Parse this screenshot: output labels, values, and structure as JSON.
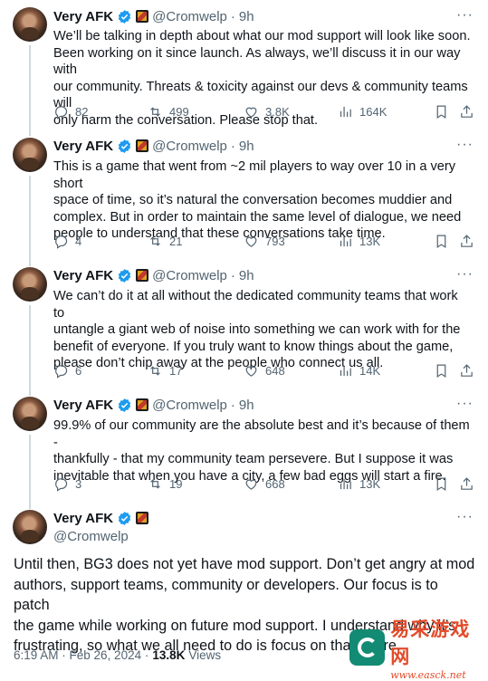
{
  "author": {
    "name": "Very AFK",
    "handle": "@Cromwelp"
  },
  "more_label": "···",
  "tweets": [
    {
      "time": "9h",
      "text": "We’ll be talking in depth about what our mod support will look like soon.\nBeen working on it since launch. As always, we’ll discuss it in our way with\nour community. Threats & toxicity against our devs & community teams will\nonly harm the conversation. Please stop that.",
      "replies": "82",
      "retweets": "499",
      "likes": "3.8K",
      "views": "164K"
    },
    {
      "time": "9h",
      "text": "This is a game that went from ~2 mil players to way over 10 in a very short\nspace of time, so it’s natural the conversation becomes muddier and\ncomplex. But in order to maintain the same level of dialogue, we need\npeople to understand that these conversations take time.",
      "replies": "4",
      "retweets": "21",
      "likes": "793",
      "views": "13K"
    },
    {
      "time": "9h",
      "text": "We can’t do it at all without the dedicated community teams that work to\nuntangle a giant web of noise into something we can work with for the\nbenefit of everyone. If you truly want to know things about the game,\nplease don’t chip away at the people who connect us all.",
      "replies": "6",
      "retweets": "17",
      "likes": "648",
      "views": "14K"
    },
    {
      "time": "9h",
      "text": "99.9% of our community are the absolute best and it’s because of them -\nthankfully - that my community team persevere. But I suppose it was\ninevitable that when you have a city, a few bad eggs will start a fire.",
      "replies": "3",
      "retweets": "19",
      "likes": "668",
      "views": "13K"
    }
  ],
  "main_tweet": {
    "text": "Until then, BG3 does not yet have mod support. Don’t get angry at mod\nauthors, support teams, community or developers. Our focus is to patch\nthe game while working on future mod support. I understand why it’s\nfrustrating, so what we all need to do is focus on that future.",
    "date": "6:19 AM · Feb 26, 2024 ·",
    "views_count": "13.8K",
    "views_label": "Views"
  },
  "watermark": {
    "brand": "易采游戏网",
    "url": "www.easck.net"
  },
  "colors": {
    "verified": "#1d9bf0",
    "muted": "#536471",
    "thread_line": "#cfd9de"
  }
}
